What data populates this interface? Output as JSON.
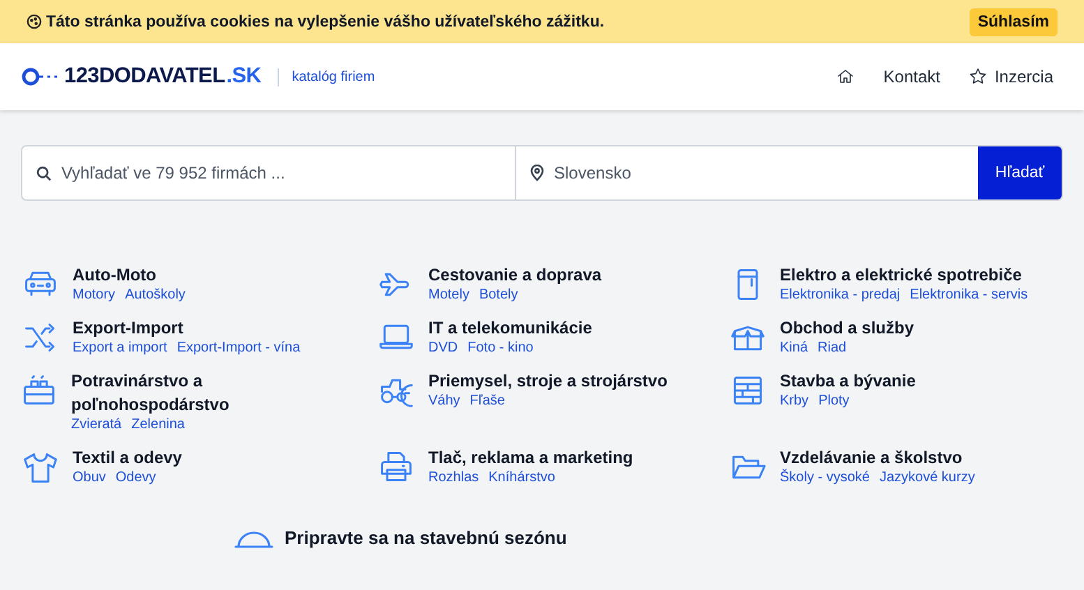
{
  "cookie_bar": {
    "text": "Táto stránka používa cookies na vylepšenie vášho užívateľského zážitku.",
    "button": "Súhlasím"
  },
  "header": {
    "logo": {
      "name": "123DODAVATEL",
      "domain": ".SK"
    },
    "tagline": "katalóg firiem",
    "nav": [
      {
        "kind": "home"
      },
      {
        "kind": "text",
        "label": "Kontakt"
      },
      {
        "kind": "star",
        "label": "Inzercia"
      }
    ]
  },
  "search": {
    "query_placeholder": "Vyhľadať ve 79 952 firmách ...",
    "location_placeholder": "Slovensko",
    "button": "Hľadať"
  },
  "categories": [
    {
      "kind": "car",
      "title": "Auto-Moto",
      "links": [
        "Motory",
        "Autoškoly"
      ]
    },
    {
      "kind": "plane",
      "title": "Cestovanie a doprava",
      "links": [
        "Motely",
        "Botely"
      ]
    },
    {
      "kind": "fridge",
      "title": "Elektro a elektrické spotrebiče",
      "links": [
        "Elektronika - predaj",
        "Elektronika - servis"
      ]
    },
    {
      "kind": "shuffle",
      "title": "Export-Import",
      "links": [
        "Export a import",
        "Export-Import - vína"
      ]
    },
    {
      "kind": "laptop",
      "title": "IT a telekomunikácie",
      "links": [
        "DVD",
        "Foto - kino"
      ]
    },
    {
      "kind": "box",
      "title": "Obchod a služby",
      "links": [
        "Kiná",
        "Riad"
      ]
    },
    {
      "kind": "crate",
      "title": "Potravinárstvo a poľnohospodárstvo",
      "links": [
        "Zvieratá",
        "Zelenina"
      ]
    },
    {
      "kind": "tractor",
      "title": "Priemysel, stroje a strojárstvo",
      "links": [
        "Váhy",
        "Fľaše"
      ]
    },
    {
      "kind": "wall",
      "title": "Stavba a bývanie",
      "links": [
        "Krby",
        "Ploty"
      ]
    },
    {
      "kind": "shirt",
      "title": "Textil a odevy",
      "links": [
        "Obuv",
        "Odevy"
      ]
    },
    {
      "kind": "printer",
      "title": "Tlač, reklama a marketing",
      "links": [
        "Rozhlas",
        "Kníhárstvo"
      ]
    },
    {
      "kind": "folder",
      "title": "Vzdelávanie a školstvo",
      "links": [
        "Školy - vysoké",
        "Jazykové kurzy"
      ]
    }
  ],
  "promo": {
    "title": "Pripravte sa na stavebnú sezónu"
  }
}
